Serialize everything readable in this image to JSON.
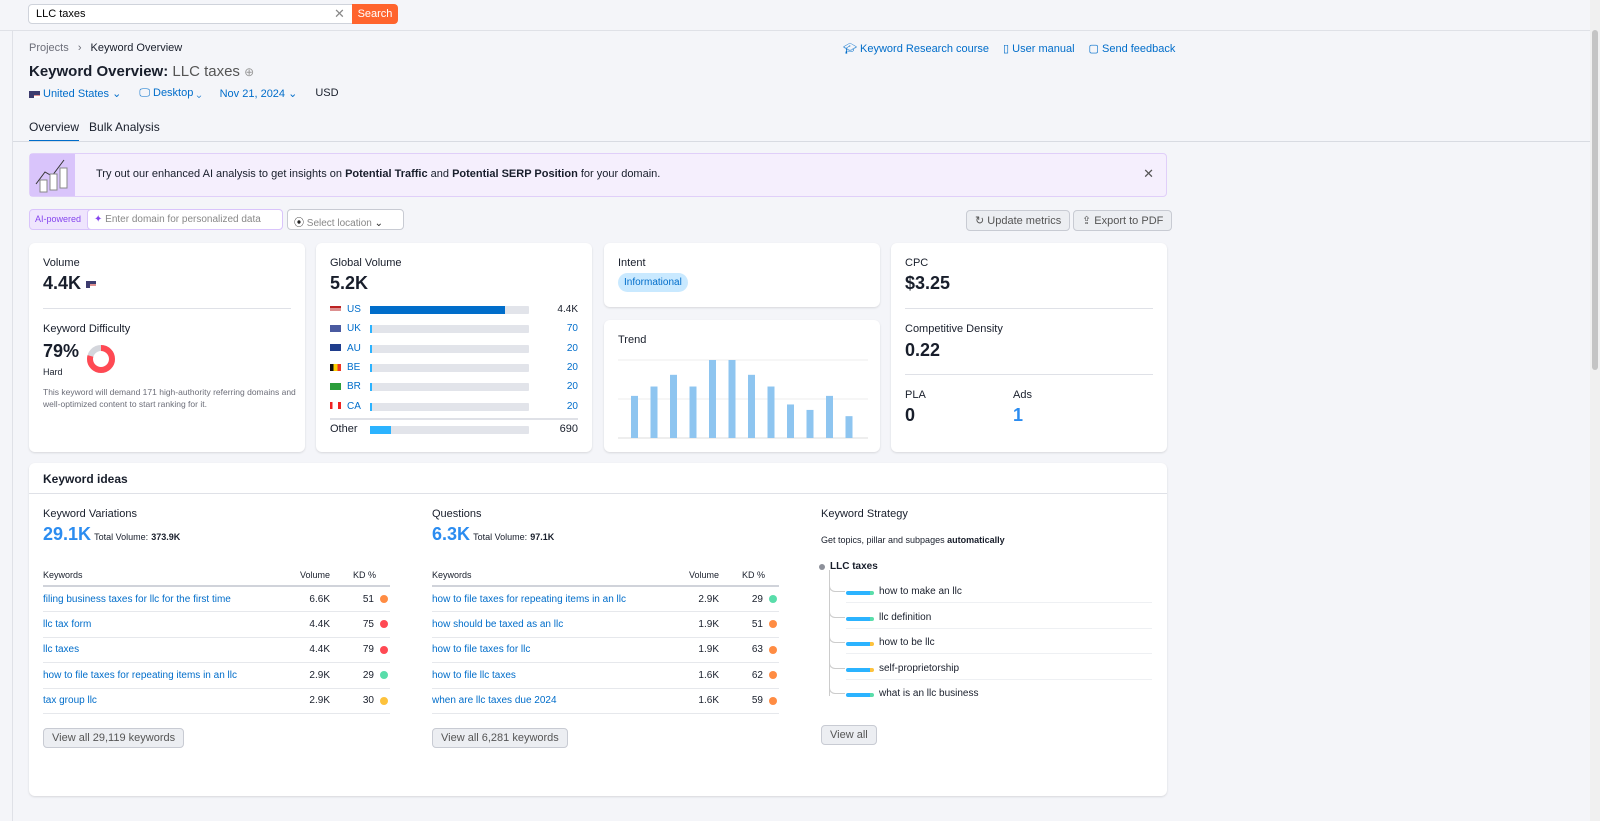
{
  "search": {
    "value": "LLC taxes",
    "button": "Search"
  },
  "breadcrumb": [
    "Projects",
    "Keyword Overview"
  ],
  "header_links": [
    "Keyword Research course",
    "User manual",
    "Send feedback"
  ],
  "title": {
    "prefix": "Keyword Overview:",
    "keyword": "LLC taxes"
  },
  "filters": {
    "country": "United States",
    "device": "Desktop",
    "date": "Nov 21, 2024",
    "currency": "USD"
  },
  "tabs": [
    "Overview",
    "Bulk Analysis"
  ],
  "banner": {
    "text1": "Try out our enhanced AI analysis to get insights on ",
    "bold1": "Potential Traffic",
    "text2": " and ",
    "bold2": "Potential SERP Position",
    "text3": " for your domain."
  },
  "ai": {
    "badge": "AI-powered",
    "placeholder": "Enter domain for personalized data",
    "location": "Select location",
    "update": "Update metrics",
    "export": "Export to PDF"
  },
  "volume": {
    "label": "Volume",
    "value": "4.4K"
  },
  "kd": {
    "label": "Keyword Difficulty",
    "value": "79%",
    "percent": 79,
    "level": "Hard",
    "desc": "This keyword will demand 171 high-authority referring domains and well-optimized content to start ranking for it.",
    "color": "#ff4953"
  },
  "global": {
    "label": "Global Volume",
    "value": "5.2K",
    "rows": [
      {
        "code": "US",
        "value": "4.4K",
        "fill": 0.85
      },
      {
        "code": "UK",
        "value": "70",
        "fill": 0.014
      },
      {
        "code": "AU",
        "value": "20",
        "fill": 0.01
      },
      {
        "code": "BE",
        "value": "20",
        "fill": 0.01
      },
      {
        "code": "BR",
        "value": "20",
        "fill": 0.01
      },
      {
        "code": "CA",
        "value": "20",
        "fill": 0.01
      }
    ],
    "other": {
      "label": "Other",
      "value": "690",
      "fill": 0.13
    }
  },
  "intent": {
    "label": "Intent",
    "value": "Informational"
  },
  "trend": {
    "label": "Trend",
    "values": [
      0.54,
      0.66,
      0.81,
      0.66,
      1,
      1,
      0.81,
      0.66,
      0.43,
      0.36,
      0.54,
      0.28
    ]
  },
  "cpc": {
    "label": "CPC",
    "value": "$3.25"
  },
  "density": {
    "label": "Competitive Density",
    "value": "0.22"
  },
  "pla": {
    "label": "PLA",
    "value": "0"
  },
  "ads": {
    "label": "Ads",
    "value": "1"
  },
  "ideas": {
    "title": "Keyword ideas",
    "variations": {
      "title": "Keyword Variations",
      "count": "29.1K",
      "total_label": "Total Volume:",
      "total": "373.9K",
      "cols": [
        "Keywords",
        "Volume",
        "KD %"
      ],
      "rows": [
        [
          "filing business taxes for llc for the first time",
          "6.6K",
          "51",
          "#ff8c43"
        ],
        [
          "llc tax form",
          "4.4K",
          "75",
          "#ff4953"
        ],
        [
          "llc taxes",
          "4.4K",
          "79",
          "#ff4953"
        ],
        [
          "how to file taxes for repeating items in an llc",
          "2.9K",
          "29",
          "#59ddaa"
        ],
        [
          "tax group llc",
          "2.9K",
          "30",
          "#fdc23c"
        ]
      ],
      "view_all": "View all 29,119 keywords"
    },
    "questions": {
      "title": "Questions",
      "count": "6.3K",
      "total_label": "Total Volume:",
      "total": "97.1K",
      "cols": [
        "Keywords",
        "Volume",
        "KD %"
      ],
      "rows": [
        [
          "how to file taxes for repeating items in an llc",
          "2.9K",
          "29",
          "#59ddaa"
        ],
        [
          "how should be taxed as an llc",
          "1.9K",
          "51",
          "#ff8c43"
        ],
        [
          "how to file taxes for llc",
          "1.9K",
          "63",
          "#ff8c43"
        ],
        [
          "how to file llc taxes",
          "1.6K",
          "62",
          "#ff8c43"
        ],
        [
          "when are llc taxes due 2024",
          "1.6K",
          "59",
          "#ff8c43"
        ]
      ],
      "view_all": "View all 6,281 keywords"
    },
    "strategy": {
      "title": "Keyword Strategy",
      "desc": "Get topics, pillar and subpages ",
      "desc_bold": "automatically",
      "root": "LLC taxes",
      "items": [
        [
          "how to make an llc",
          "#59ddaa"
        ],
        [
          "llc definition",
          "#59ddaa"
        ],
        [
          "how to be llc",
          "#fdc23c"
        ],
        [
          "self-proprietorship",
          "#fdc23c"
        ],
        [
          "what is an llc business",
          "#59ddaa"
        ]
      ],
      "view_all": "View all"
    }
  }
}
